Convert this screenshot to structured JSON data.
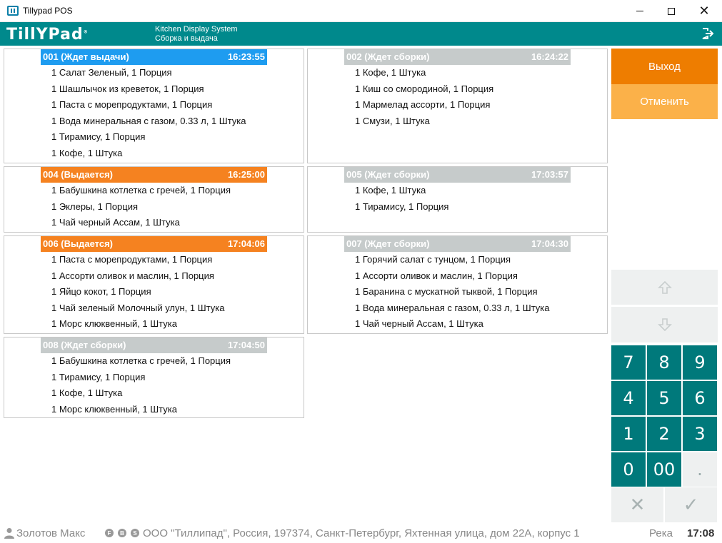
{
  "window": {
    "title": "Tillypad POS"
  },
  "header": {
    "logo": "TillYPad",
    "line1": "Kitchen Display System",
    "line2": "Сборка и выдача"
  },
  "orders": [
    {
      "number": "001 (Ждет выдачи)",
      "time": "16:23:55",
      "status": "waiting-out",
      "items": [
        "1 Салат Зеленый, 1 Порция",
        "1 Шашлычок из креветок, 1 Порция",
        "1 Паста с морепродуктами, 1 Порция",
        "1 Вода минеральная с газом, 0.33 л, 1 Штука",
        "1 Тирамису, 1 Порция",
        "1 Кофе, 1 Штука"
      ]
    },
    {
      "number": "002 (Ждет сборки)",
      "time": "16:24:22",
      "status": "waiting-pack",
      "items": [
        "1 Кофе, 1 Штука",
        "1 Киш со смородиной, 1 Порция",
        "1 Мармелад ассорти, 1 Порция",
        "1 Смузи, 1 Штука"
      ]
    },
    {
      "number": "004 (Выдается)",
      "time": "16:25:00",
      "status": "issuing",
      "items": [
        "1 Бабушкина котлетка с гречей, 1 Порция",
        "1 Эклеры, 1 Порция",
        "1 Чай черный Ассам, 1 Штука"
      ]
    },
    {
      "number": "005 (Ждет сборки)",
      "time": "17:03:57",
      "status": "waiting-pack",
      "items": [
        "1 Кофе, 1 Штука",
        "1 Тирамису, 1 Порция"
      ]
    },
    {
      "number": "006 (Выдается)",
      "time": "17:04:06",
      "status": "issuing",
      "items": [
        "1 Паста с морепродуктами, 1 Порция",
        "1 Ассорти оливок и маслин, 1 Порция",
        "1 Яйцо кокот, 1 Порция",
        "1 Чай зеленый Молочный улун, 1 Штука",
        "1 Морс клюквенный, 1 Штука"
      ]
    },
    {
      "number": "007 (Ждет сборки)",
      "time": "17:04:30",
      "status": "waiting-pack",
      "items": [
        "1 Горячий салат с тунцом, 1 Порция",
        "1 Ассорти оливок и маслин, 1 Порция",
        "1 Баранина с мускатной тыквой, 1 Порция",
        "1 Вода минеральная с газом, 0.33 л, 1 Штука",
        "1 Чай черный Ассам, 1 Штука"
      ]
    },
    {
      "number": "008 (Ждет сборки)",
      "time": "17:04:50",
      "status": "waiting-pack",
      "items": [
        "1 Бабушкина котлетка с гречей, 1 Порция",
        "1 Тирамису, 1 Порция",
        "1 Кофе, 1 Штука",
        "1 Морс клюквенный, 1 Штука"
      ]
    }
  ],
  "panel": {
    "exit_label": "Выход",
    "cancel_label": "Отменить",
    "up_icon": "arrow-up-icon",
    "down_icon": "arrow-down-icon",
    "keys": [
      "7",
      "8",
      "9",
      "4",
      "5",
      "6",
      "1",
      "2",
      "3",
      "0",
      "00",
      "."
    ],
    "clear_glyph": "✕",
    "confirm_glyph": "✓"
  },
  "statusbar": {
    "user": "Золотов Макс",
    "badges": [
      "F",
      "B",
      "S"
    ],
    "company": "ООО \"Тиллипад\", Россия, 197374, Санкт-Петербург, Яхтенная улица, дом 22А, корпус 1",
    "place": "Река",
    "time": "17:08"
  },
  "colors": {
    "brand": "#00898c",
    "key": "#00797b",
    "waiting_out": "#1e9cf0",
    "issuing": "#f58220",
    "waiting_pack": "#c6cbcb",
    "exit": "#ee7d00",
    "cancel": "#fbb149"
  }
}
